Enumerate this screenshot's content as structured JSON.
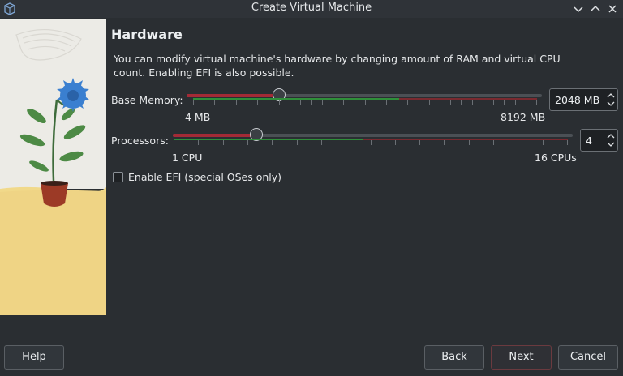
{
  "window": {
    "title": "Create Virtual Machine"
  },
  "header": {
    "section_title": "Hardware",
    "description": "You can modify virtual machine's hardware by changing amount of RAM and virtual CPU count. Enabling EFI is also possible."
  },
  "memory": {
    "label": "Base Memory:",
    "min_label": "4 MB",
    "max_label": "8192 MB",
    "value": "2048 MB",
    "level": 0.25
  },
  "processors": {
    "label": "Processors:",
    "min_label": "1 CPU",
    "max_label": "16 CPUs",
    "value": "4",
    "level": 0.2
  },
  "efi": {
    "label": "Enable EFI (special OSes only)",
    "checked": false
  },
  "buttons": {
    "help": "Help",
    "back": "Back",
    "next": "Next",
    "cancel": "Cancel"
  },
  "colors": {
    "background": "#2a2e32",
    "slider_fill": "#a32a36",
    "tick_green": "#2f8f3a",
    "tick_red": "#7a2a30"
  },
  "icons": [
    "virtualbox-icon",
    "chevron-down-icon",
    "chevron-up-icon",
    "close-icon",
    "spin-up-icon",
    "spin-down-icon"
  ]
}
